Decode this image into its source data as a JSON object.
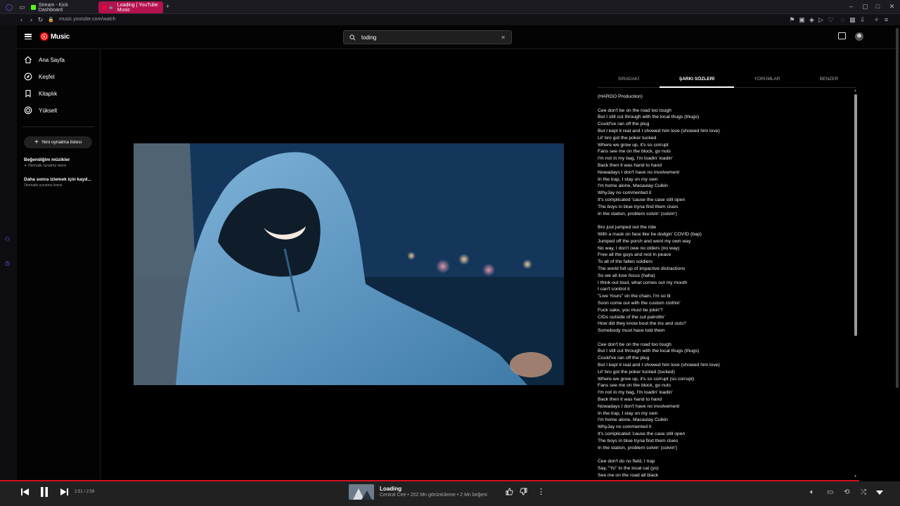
{
  "browser": {
    "tabs": [
      {
        "label": "Stream - Kick Dashboard"
      },
      {
        "label": "Loading | YouTube Music"
      }
    ],
    "url": "music.youtube.com/watch"
  },
  "header": {
    "logo_text": "Music",
    "search": {
      "value": "loding"
    }
  },
  "sidebar": {
    "items": [
      {
        "label": "Ana Sayfa",
        "icon": "home-icon"
      },
      {
        "label": "Keşfet",
        "icon": "compass-icon"
      },
      {
        "label": "Kitaplık",
        "icon": "bookmark-icon"
      },
      {
        "label": "Yükselt",
        "icon": "upgrade-icon"
      }
    ],
    "new_playlist": "Yeni oynatma listesi",
    "playlists": [
      {
        "title": "Beğendiğim müzikler",
        "subtitle": "Otomatik oynatma listesi"
      },
      {
        "title": "Daha sonra izlemek için kayd...",
        "subtitle": "Otomatik oynatma listesi"
      }
    ]
  },
  "panel": {
    "tabs": [
      "SIRADAKİ",
      "ŞARKI SÖZLERİ",
      "YORUMLAR",
      "BENZER"
    ],
    "active_tab": 1,
    "lyrics": [
      [
        "(HARGO Production)"
      ],
      [
        "Cee don't be on the road too tough",
        "But I still cut through with the local thugs (thugs)",
        "Could've ran off the plug",
        "But I kept it real and I showed him love (showed him love)",
        "Lil' bro got the poker tucked",
        "Where we grow up, it's so corrupt",
        "Fans see me on the block, go nuts",
        "I'm not in my bag, I'm loadin' loadin'",
        "Back then it was hand to hand",
        "Nowadays I don't have no involvement",
        "In the trap, I stay on my own",
        "I'm home alone, Macaulay Culkin",
        "WhyJay no commented it",
        "It's complicated 'cause the case still open",
        "The boys in blue tryna find them clues",
        "In the station, problem solvin' (solvin')"
      ],
      [
        "Bro just jumped out the ride",
        "With a mask on face like he dodgin' COVID (bap)",
        "Jumped off the porch and went my own way",
        "No way, I don't owe no olders (no way)",
        "Free all the guys and rest in peace",
        "To all of the fallen soldiers",
        "The world full up of impactive distractions",
        "So we all lose focus (haha)",
        "I think out loud, what comes out my mouth",
        "I can't control it",
        "\"Live Yours\" on the chain, I'm so lit",
        "Soon come out with the custom clothin'",
        "Fuck sake, you must be jokin'?",
        "CIDs outside of the cut patrollin'",
        "How did they know bout the ins and outs?",
        "Somebody must have told them"
      ],
      [
        "Cee don't be on the road too tough",
        "But I still cut through with the local thugs (thugs)",
        "Could've ran off the plug",
        "But I kept it real and I showed him love (showed him love)",
        "Lil' bro got the poker tucked (tucked)",
        "Where we grow up, it's so corrupt (so corrupt)",
        "Fans see me on the block, go nuts",
        "I'm not in my bag, I'm loadin' loadin'",
        "Back then it was hand to hand",
        "Nowadays I don't have no involvement",
        "In the trap, I stay on my own",
        "I'm home alone, Macaulay Culkin",
        "WhyJay no commented it",
        "It's complicated 'cause the case still open",
        "The boys in blue tryna find them clues",
        "In the station, problem solvin' (solvin')"
      ],
      [
        "Cee don't do no field, I trap",
        "Say, \"Yo\" to the local cat (yo)",
        "See me on the road all black"
      ]
    ]
  },
  "player": {
    "time": "2:51 / 2:59",
    "progress_fraction": 0.955,
    "title": "Loading",
    "subtitle": "Central Cee • 202 Mn görüntüleme • 2 Mn beğeni"
  },
  "colors": {
    "accent": "#ff0000",
    "progress": "#d40f20",
    "tab_active": "#b4124f"
  }
}
